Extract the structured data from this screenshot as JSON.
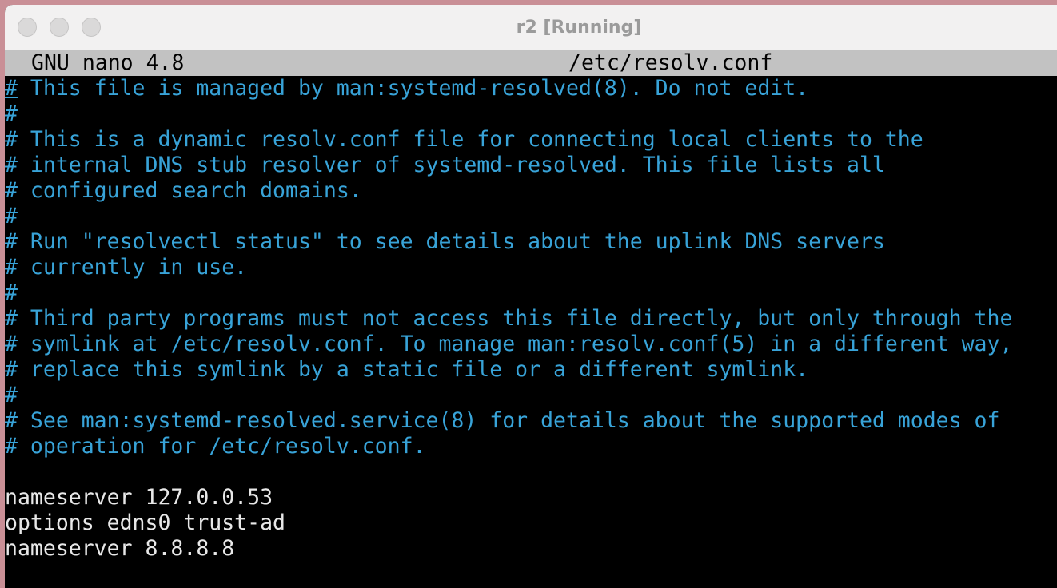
{
  "window": {
    "title": "r2 [Running]"
  },
  "nano": {
    "version": "GNU nano 4.8",
    "filename": "/etc/resolv.conf"
  },
  "colors": {
    "comment": "#38a3d8",
    "plain": "#e8e8e8",
    "header_bg": "#c2c2c2",
    "terminal_bg": "#000000"
  },
  "lines": [
    {
      "text": "# This file is managed by man:systemd-resolved(8). Do not edit.",
      "kind": "comment"
    },
    {
      "text": "#",
      "kind": "comment"
    },
    {
      "text": "# This is a dynamic resolv.conf file for connecting local clients to the",
      "kind": "comment"
    },
    {
      "text": "# internal DNS stub resolver of systemd-resolved. This file lists all",
      "kind": "comment"
    },
    {
      "text": "# configured search domains.",
      "kind": "comment"
    },
    {
      "text": "#",
      "kind": "comment"
    },
    {
      "text": "# Run \"resolvectl status\" to see details about the uplink DNS servers",
      "kind": "comment"
    },
    {
      "text": "# currently in use.",
      "kind": "comment"
    },
    {
      "text": "#",
      "kind": "comment"
    },
    {
      "text": "# Third party programs must not access this file directly, but only through the",
      "kind": "comment"
    },
    {
      "text": "# symlink at /etc/resolv.conf. To manage man:resolv.conf(5) in a different way,",
      "kind": "comment"
    },
    {
      "text": "# replace this symlink by a static file or a different symlink.",
      "kind": "comment"
    },
    {
      "text": "#",
      "kind": "comment"
    },
    {
      "text": "# See man:systemd-resolved.service(8) for details about the supported modes of",
      "kind": "comment"
    },
    {
      "text": "# operation for /etc/resolv.conf.",
      "kind": "comment"
    },
    {
      "text": "",
      "kind": "plain"
    },
    {
      "text": "nameserver 127.0.0.53",
      "kind": "plain"
    },
    {
      "text": "options edns0 trust-ad",
      "kind": "plain"
    },
    {
      "text": "nameserver 8.8.8.8",
      "kind": "plain"
    }
  ]
}
